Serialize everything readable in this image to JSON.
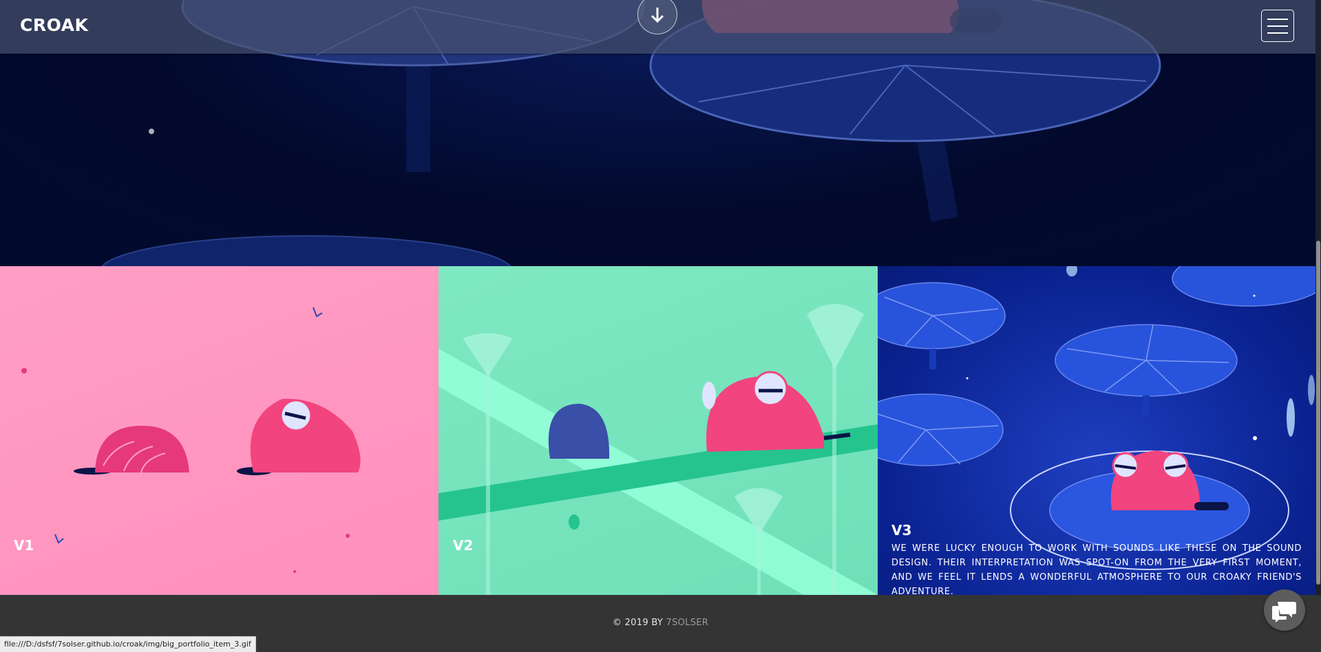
{
  "navbar": {
    "brand": "CROAK"
  },
  "portfolio": {
    "tiles": [
      {
        "label": "V1"
      },
      {
        "label": "V2"
      },
      {
        "label": "V3",
        "description": "We were lucky enough to work with sounds like these on the sound design. Their interpretation was spot-on from the very first moment, and we feel it lends a wonderful atmosphere to our croaky friend's adventure."
      }
    ]
  },
  "footer": {
    "copyright_prefix": "© 2019 BY",
    "author_link": "7SOLSER"
  },
  "status_bar": {
    "url": "file:///D:/dsfsf/7solser.github.io/croak/img/big_portfolio_item_3.gif"
  },
  "colors": {
    "tile_v1": "#ff9ec4",
    "tile_v2": "#7fe8c2",
    "tile_v3": "#0a2290",
    "hero_bg": "#02092c",
    "footer_bg": "#343434"
  }
}
